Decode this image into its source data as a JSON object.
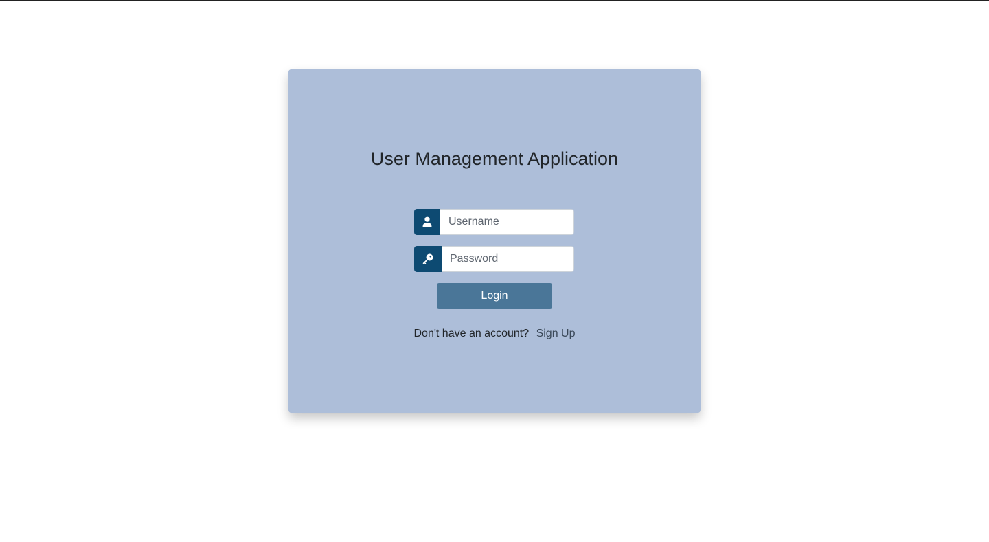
{
  "app": {
    "title": "User Management Application"
  },
  "login_form": {
    "username": {
      "placeholder": "Username",
      "value": "",
      "icon": "user-icon"
    },
    "password": {
      "placeholder": "Password",
      "value": "",
      "icon": "key-icon"
    },
    "login_label": "Login"
  },
  "signup": {
    "prompt": "Don't have an account?",
    "link_label": "Sign Up"
  },
  "colors": {
    "card_background": "#adbed9",
    "icon_addon": "#0d4a72",
    "login_button": "#4a7698"
  }
}
